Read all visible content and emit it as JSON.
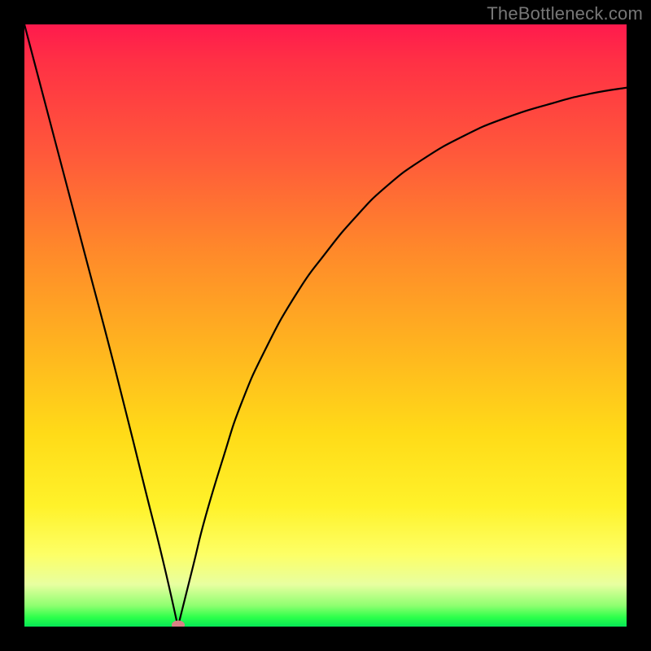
{
  "watermark": "TheBottleneck.com",
  "chart_data": {
    "type": "line",
    "title": "",
    "xlabel": "",
    "ylabel": "",
    "xlim": [
      0,
      100
    ],
    "ylim": [
      0,
      100
    ],
    "grid": false,
    "series": [
      {
        "name": "bottleneck-curve",
        "x": [
          0,
          5,
          10,
          15,
          20,
          23,
          25.5,
          28,
          30,
          33,
          36,
          40,
          45,
          50,
          55,
          60,
          66,
          73,
          80,
          88,
          94,
          100
        ],
        "values": [
          100,
          81,
          62,
          43,
          23,
          11,
          0,
          10,
          18,
          28,
          37,
          46,
          55,
          62,
          68,
          73,
          77.5,
          81.5,
          84.5,
          87,
          88.5,
          89.5
        ]
      }
    ],
    "marker": {
      "x": 25.5,
      "y": 0,
      "name": "bottleneck-point"
    },
    "background_gradient": {
      "stops": [
        {
          "pos": 0,
          "color": "#ff1a4d"
        },
        {
          "pos": 0.38,
          "color": "#ff8a2a"
        },
        {
          "pos": 0.68,
          "color": "#ffdb18"
        },
        {
          "pos": 0.88,
          "color": "#fdff66"
        },
        {
          "pos": 1.0,
          "color": "#06e756"
        }
      ]
    }
  }
}
